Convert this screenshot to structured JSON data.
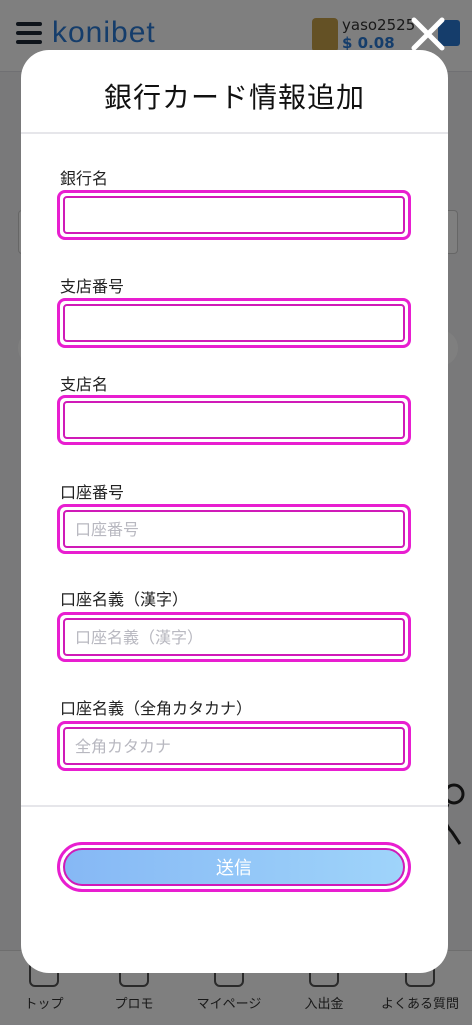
{
  "header": {
    "logo_text": "konibet",
    "username": "yaso2525",
    "balance": "$ 0.08"
  },
  "nav": {
    "items": [
      {
        "label": "トップ"
      },
      {
        "label": "プロモ"
      },
      {
        "label": "マイページ"
      },
      {
        "label": "入出金"
      },
      {
        "label": "よくある質問"
      }
    ]
  },
  "modal": {
    "title": "銀行カード情報追加",
    "fields": [
      {
        "label": "銀行名",
        "value": "",
        "placeholder": ""
      },
      {
        "label": "支店番号",
        "value": "",
        "placeholder": ""
      },
      {
        "label": "支店名",
        "value": "",
        "placeholder": ""
      },
      {
        "label": "口座番号",
        "value": "",
        "placeholder": "口座番号"
      },
      {
        "label": "口座名義（漢字）",
        "value": "",
        "placeholder": "口座名義（漢字）"
      },
      {
        "label": "口座名義（全角カタカナ）",
        "value": "",
        "placeholder": "全角カタカナ"
      }
    ],
    "submit_label": "送信"
  },
  "colors": {
    "highlight": "#e81ed0",
    "button_gradient_start": "#86b8f5",
    "button_gradient_end": "#9fd4fa",
    "overlay": "rgba(0,0,0,0.5)"
  },
  "icons": [
    "hamburger-icon",
    "close-icon",
    "avatar-icon"
  ]
}
